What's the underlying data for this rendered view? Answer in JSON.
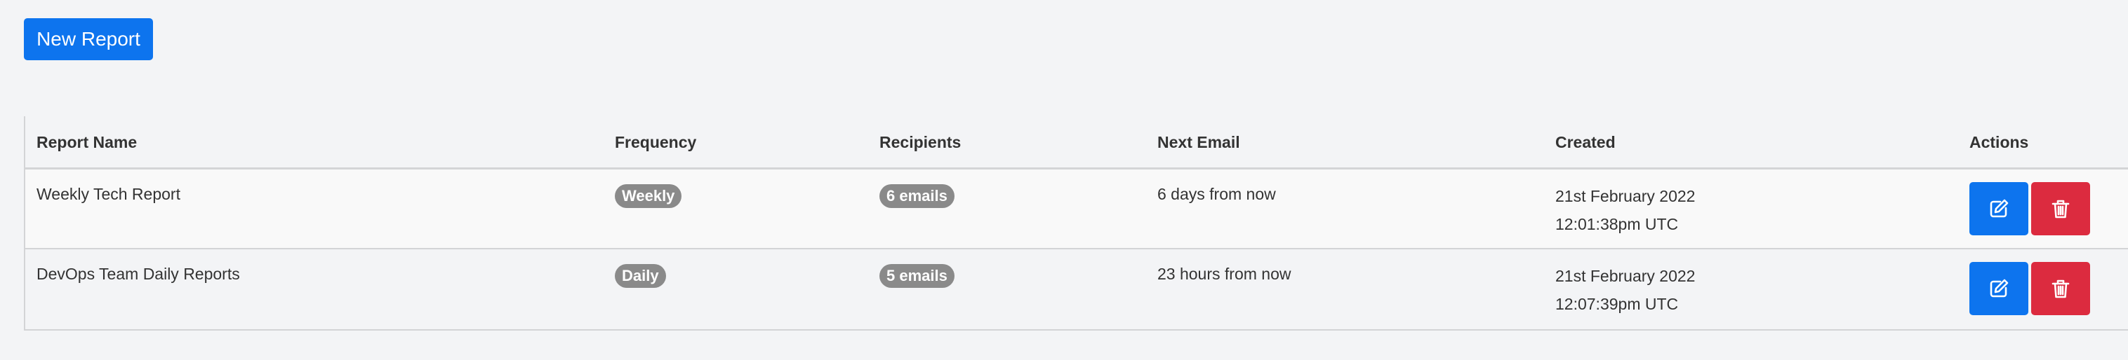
{
  "toolbar": {
    "new_report_label": "New Report"
  },
  "table": {
    "headers": {
      "name": "Report Name",
      "frequency": "Frequency",
      "recipients": "Recipients",
      "next_email": "Next Email",
      "created": "Created",
      "actions": "Actions"
    },
    "rows": [
      {
        "name": "Weekly Tech Report",
        "frequency": "Weekly",
        "recipients": "6 emails",
        "next_email": "6 days from now",
        "created_date": "21st February 2022",
        "created_time": "12:01:38pm UTC"
      },
      {
        "name": "DevOps Team Daily Reports",
        "frequency": "Daily",
        "recipients": "5 emails",
        "next_email": "23 hours from now",
        "created_date": "21st February 2022",
        "created_time": "12:07:39pm UTC"
      }
    ]
  },
  "icons": {
    "edit": "edit-icon",
    "delete": "trash-icon"
  },
  "colors": {
    "primary": "#0d74ee",
    "danger": "#dc2b3f",
    "badge": "#8a8a8a",
    "background": "#f3f4f6"
  }
}
